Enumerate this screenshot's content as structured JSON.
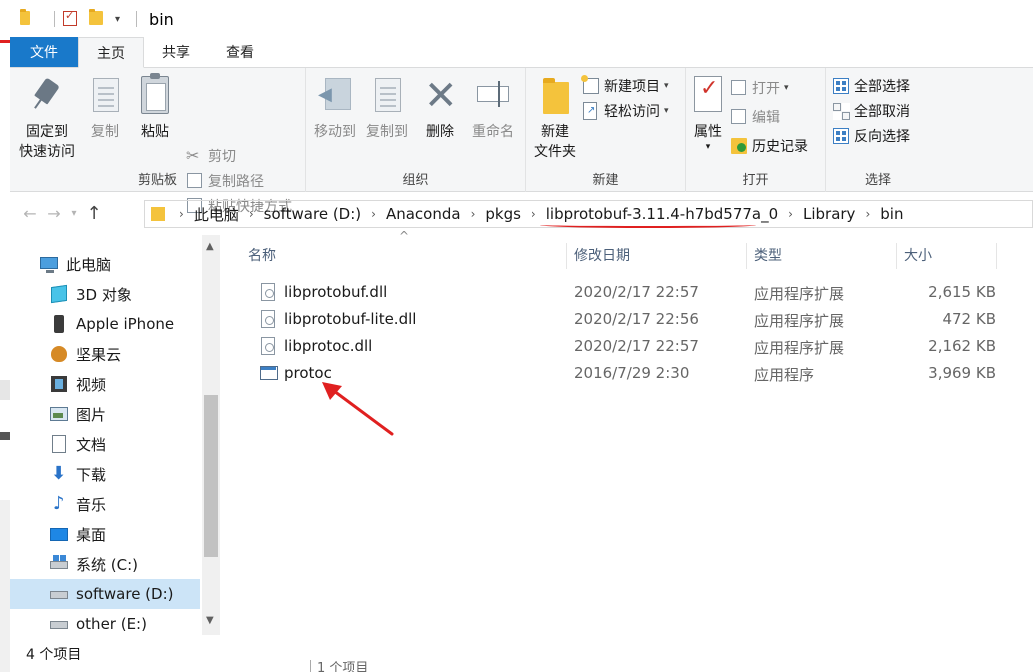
{
  "title_bar": {
    "title": "bin"
  },
  "ribbon_tabs": [
    {
      "label": "文件"
    },
    {
      "label": "主页"
    },
    {
      "label": "共享"
    },
    {
      "label": "查看"
    }
  ],
  "ribbon": {
    "clipboard": {
      "group_label": "剪贴板",
      "pin_line1": "固定到",
      "pin_line2": "快速访问",
      "copy": "复制",
      "paste": "粘贴",
      "cut": "剪切",
      "copy_path": "复制路径",
      "paste_shortcut": "粘贴快捷方式"
    },
    "organize": {
      "group_label": "组织",
      "move_to": "移动到",
      "copy_to": "复制到",
      "delete": "删除",
      "rename": "重命名"
    },
    "new": {
      "group_label": "新建",
      "new_item": "新建项目",
      "easy_access": "轻松访问",
      "new_folder_line1": "新建",
      "new_folder_line2": "文件夹"
    },
    "open": {
      "group_label": "打开",
      "properties": "属性",
      "open": "打开",
      "edit": "编辑",
      "history": "历史记录"
    },
    "select": {
      "group_label": "选择",
      "select_all": "全部选择",
      "select_none": "全部取消",
      "invert": "反向选择"
    }
  },
  "address_bar": {
    "crumbs": [
      "此电脑",
      "software (D:)",
      "Anaconda",
      "pkgs",
      "libprotobuf-3.11.4-h7bd577a_0",
      "Library",
      "bin"
    ]
  },
  "nav_pane": {
    "items": [
      {
        "label": "此电脑",
        "icon": "computer-icon"
      },
      {
        "label": "3D 对象",
        "icon": "3d-objects-icon"
      },
      {
        "label": "Apple iPhone",
        "icon": "phone-icon"
      },
      {
        "label": "坚果云",
        "icon": "jianguoyun-icon"
      },
      {
        "label": "视频",
        "icon": "video-icon"
      },
      {
        "label": "图片",
        "icon": "pictures-icon"
      },
      {
        "label": "文档",
        "icon": "documents-icon"
      },
      {
        "label": "下载",
        "icon": "downloads-icon"
      },
      {
        "label": "音乐",
        "icon": "music-icon"
      },
      {
        "label": "桌面",
        "icon": "desktop-icon"
      },
      {
        "label": "系统 (C:)",
        "icon": "system-drive-icon"
      },
      {
        "label": "software (D:)",
        "icon": "drive-icon"
      },
      {
        "label": "other (E:)",
        "icon": "drive-icon"
      }
    ],
    "selected_index": 11
  },
  "file_list": {
    "columns": [
      "名称",
      "修改日期",
      "类型",
      "大小"
    ],
    "rows": [
      {
        "name": "libprotobuf.dll",
        "modified": "2020/2/17 22:57",
        "type": "应用程序扩展",
        "size": "2,615 KB",
        "icon": "dll-file-icon"
      },
      {
        "name": "libprotobuf-lite.dll",
        "modified": "2020/2/17 22:56",
        "type": "应用程序扩展",
        "size": "472 KB",
        "icon": "dll-file-icon"
      },
      {
        "name": "libprotoc.dll",
        "modified": "2020/2/17 22:57",
        "type": "应用程序扩展",
        "size": "2,162 KB",
        "icon": "dll-file-icon"
      },
      {
        "name": "protoc",
        "modified": "2016/7/29 2:30",
        "type": "应用程序",
        "size": "3,969 KB",
        "icon": "exe-file-icon"
      }
    ]
  },
  "status_bar": {
    "item_count": "4 个项目",
    "behind_window_text": "1 个项目"
  },
  "colors": {
    "file_tab": "#1979ca",
    "selection": "#cce4f7",
    "annotation_red": "#e02020"
  }
}
